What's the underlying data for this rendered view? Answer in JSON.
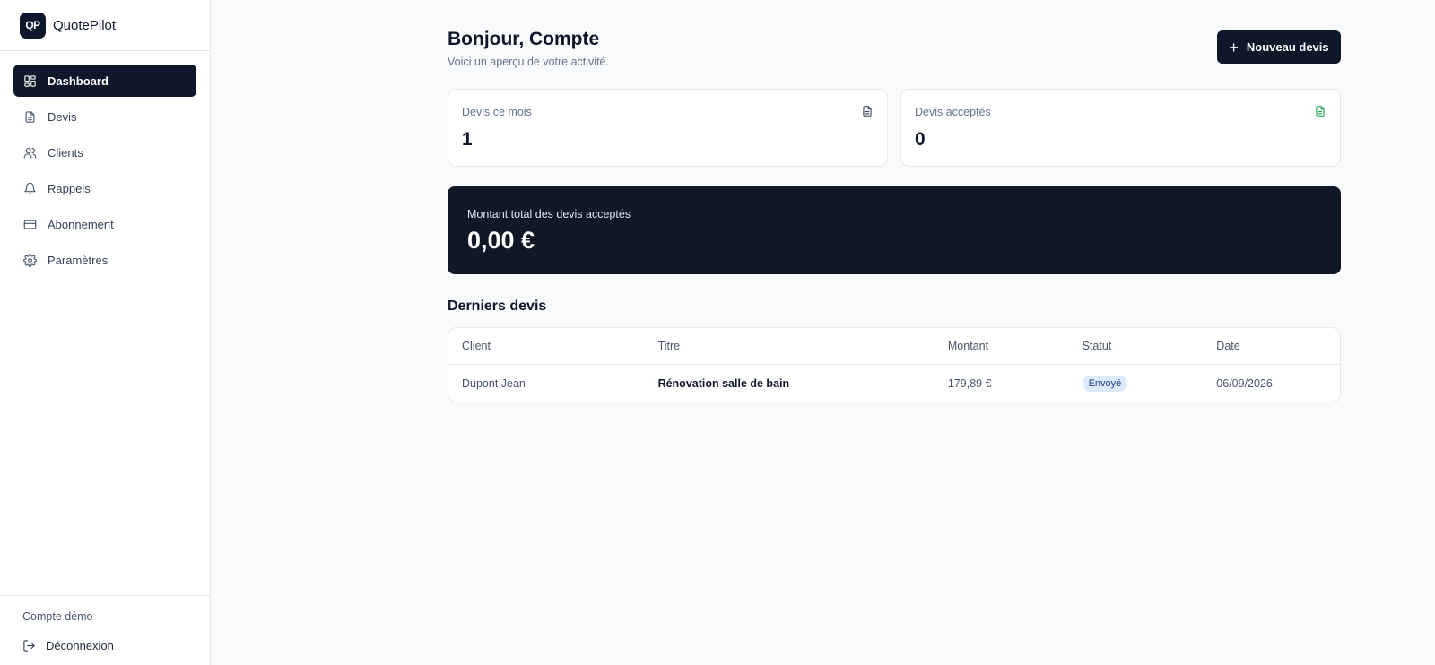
{
  "app": {
    "logo_text": "QP",
    "name": "QuotePilot"
  },
  "sidebar": {
    "items": [
      {
        "label": "Dashboard",
        "icon": "dashboard-icon",
        "active": true
      },
      {
        "label": "Devis",
        "icon": "file-icon",
        "active": false
      },
      {
        "label": "Clients",
        "icon": "users-icon",
        "active": false
      },
      {
        "label": "Rappels",
        "icon": "bell-icon",
        "active": false
      },
      {
        "label": "Abonnement",
        "icon": "credit-card-icon",
        "active": false
      },
      {
        "label": "Paramètres",
        "icon": "gear-icon",
        "active": false
      }
    ],
    "account_name": "Compte démo",
    "logout_label": "Déconnexion"
  },
  "header": {
    "greeting": "Bonjour, Compte",
    "subtitle": "Voici un aperçu de votre activité.",
    "new_quote_label": "Nouveau devis"
  },
  "stats": [
    {
      "label": "Devis ce mois",
      "value": "1",
      "icon": "file-icon",
      "icon_color": "#334155"
    },
    {
      "label": "Devis acceptés",
      "value": "0",
      "icon": "file-check-icon",
      "icon_color": "#16a34a"
    }
  ],
  "total": {
    "label": "Montant total des devis acceptés",
    "value": "0,00 €"
  },
  "recent": {
    "title": "Derniers devis",
    "columns": [
      "Client",
      "Titre",
      "Montant",
      "Statut",
      "Date"
    ],
    "rows": [
      {
        "client": "Dupont Jean",
        "titre": "Rénovation salle de bain",
        "montant": "179,89 €",
        "statut": "Envoyé",
        "date": "06/09/2026"
      }
    ]
  },
  "colors": {
    "accent": "#0f172a",
    "total_card": "#101828",
    "badge_bg": "#dbeafe",
    "badge_text": "#1e3a8a",
    "success": "#16a34a"
  }
}
